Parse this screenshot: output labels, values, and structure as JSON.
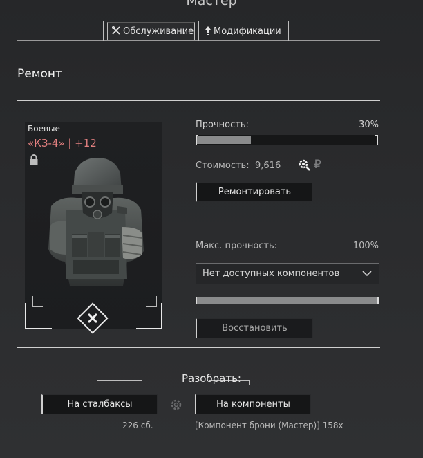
{
  "window": {
    "title": "Мастер"
  },
  "tabs": [
    {
      "label": "Обслуживание",
      "icon": "wrench-cross-icon",
      "active": true
    },
    {
      "label": "Модификации",
      "icon": "upgrade-arrow-icon",
      "active": false
    }
  ],
  "repair": {
    "section_title": "Ремонт",
    "durability_label": "Прочность:",
    "durability_value": "30%",
    "durability_fraction": 0.3,
    "cost_label": "Стоимость:",
    "cost_value": "9,616",
    "repair_button": "Ремонтировать"
  },
  "item": {
    "category": "Боевые",
    "name": "«КЗ-4» | +12",
    "locked": true,
    "name_color": "#e07f7f"
  },
  "max_durability": {
    "label": "Макс. прочность:",
    "value": "100%",
    "fraction": 1.0,
    "dropdown_selected": "Нет доступных компонентов",
    "restore_button": "Восстановить"
  },
  "disassemble": {
    "title": "Разобрать:",
    "stalbucks_button": "На сталбаксы",
    "components_button": "На компоненты",
    "stalbucks_amount": "226 сб.",
    "components_result": "[Компонент брони (Мастер)] 158x"
  }
}
